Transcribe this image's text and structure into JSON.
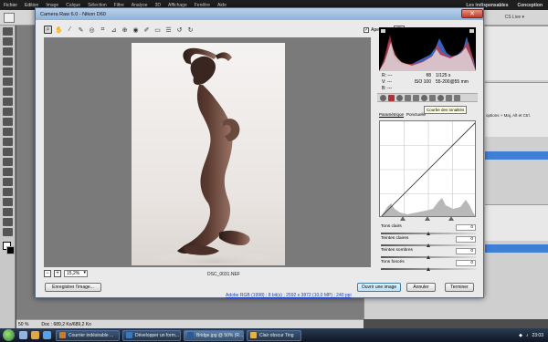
{
  "photoshop": {
    "menu": [
      "Fichier",
      "Edition",
      "Image",
      "Calque",
      "Sélection",
      "Filtre",
      "Analyse",
      "3D",
      "Affichage",
      "Fenêtre",
      "Aide"
    ],
    "workspace": [
      "Les indispensables",
      "Conception"
    ],
    "cs_live": "CS Live ▾",
    "status_zoom": "50 %",
    "status_doc": "Doc : 689,2 Ko/689,2 Ko",
    "panel_hint": "options + Maj, Alt et Ctrl."
  },
  "dialog": {
    "title": "Camera Raw 6.0  -  Nikon D60",
    "close_label": "✕",
    "preview_label": "Aperçu",
    "preview_checked": "✓",
    "zoom_value": "15,2%",
    "zoom_minus": "−",
    "zoom_plus": "+",
    "filename": "DSC_0031.NEF",
    "info": {
      "rgb_r": "R: ---",
      "rgb_g": "V: ---",
      "rgb_b": "B: ---",
      "aperture": "f/8",
      "shutter": "1/125 s",
      "iso": "ISO 100",
      "lens": "55-200@55 mm"
    },
    "tooltip": "Courbe des tonalités",
    "subtabs": [
      "Paramétrique",
      "Ponctuelle"
    ],
    "sliders": [
      {
        "label": "Tons clairs",
        "value": "0",
        "pos": 0.5
      },
      {
        "label": "Teintes claires",
        "value": "0",
        "pos": 0.5
      },
      {
        "label": "Teintes sombres",
        "value": "0",
        "pos": 0.5
      },
      {
        "label": "Tons foncés",
        "value": "0",
        "pos": 0.5
      }
    ],
    "buttons": {
      "save": "Enregistrer l'image...",
      "open": "Ouvrir une image",
      "cancel": "Annuler",
      "done": "Terminer"
    },
    "workflow_link": "Adobe RGB (1998) ; 8 bit(s) ; 2592 x 3872 (10,0 MP) ; 240 ppi"
  },
  "taskbar": {
    "tasks": [
      "Courrier indésirable ...",
      "Développer un form...",
      "Bridge.jpg @ 50% (R...",
      "Clair obscur Ting"
    ],
    "time": "23:03"
  },
  "colors": {
    "dialog_title": "#9dbfe2",
    "primary_button": "#bfe0f7",
    "histogram_bg": "#000000"
  }
}
